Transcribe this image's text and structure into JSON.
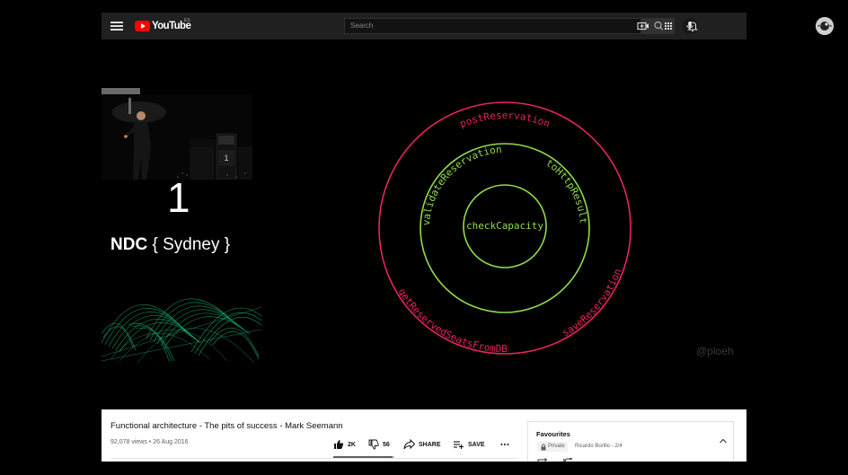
{
  "header": {
    "logo_text": "YouTube",
    "region": "ES",
    "search_placeholder": "Search"
  },
  "slide": {
    "number": "1",
    "conference_bold": "NDC",
    "conference_city": "{ Sydney }",
    "watermark": "@ploeh",
    "onion": {
      "outer_labels": [
        "postReservation",
        "getReservedSeatsFromDB",
        "saveReservation"
      ],
      "middle_labels": [
        "validateReservation",
        "toHttpResult"
      ],
      "center_label": "checkCapacity"
    }
  },
  "video": {
    "title": "Functional architecture - The pits of success - Mark Seemann",
    "views": "92,078 views",
    "date": "26 Aug 2016",
    "views_date": "92,078 views • 26 Aug 2016",
    "likes": "2K",
    "dislikes": "56",
    "like_ratio": 0.97,
    "share_label": "SHARE",
    "save_label": "SAVE"
  },
  "playlist": {
    "title": "Favourites",
    "privacy": "Private",
    "owner_position": "Ricardo Borillo - 2/4"
  },
  "colors": {
    "outer_ring": "#e8245a",
    "inner_rings": "#8fdc4a",
    "youtube_red": "#ff0000"
  },
  "icons": [
    "menu-icon",
    "youtube-logo-icon",
    "search-icon",
    "mic-icon",
    "create-video-icon",
    "apps-icon",
    "bell-icon",
    "avatar",
    "like-icon",
    "dislike-icon",
    "share-icon",
    "save-icon",
    "more-icon",
    "lock-icon",
    "chevron-up-icon",
    "loop-icon",
    "shuffle-icon"
  ]
}
